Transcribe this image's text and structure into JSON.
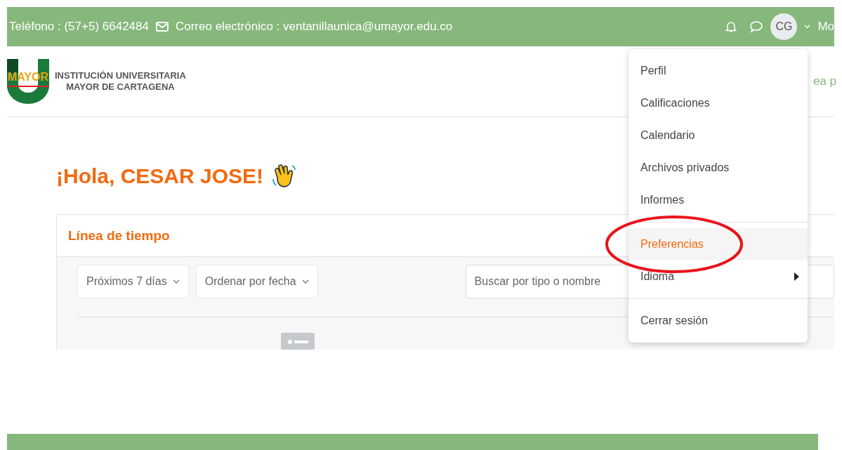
{
  "top_bar": {
    "phone": "Teléfono : (57+5) 6642484",
    "email": "Correo electrónico : ventanillaunica@umayor.edu.co",
    "avatar": "CG",
    "user_menu_partial": "Mo"
  },
  "logo": {
    "mark": "MAYOR",
    "line_1": "INSTITUCIÓN UNIVERSITARIA",
    "line_2": "MAYOR DE CARTAGENA"
  },
  "nav_partial": "ea p",
  "greeting": "¡Hola, CESAR JOSE!",
  "timeline": {
    "title": "Línea de tiempo",
    "filters": [
      {
        "label": "Próximos 7 días"
      },
      {
        "label": "Ordenar por fecha"
      }
    ],
    "search": {
      "placeholder": "Buscar por tipo o nombre"
    }
  },
  "user_menu": {
    "items": [
      {
        "kind": "item",
        "label": "Perfil",
        "selected": false
      },
      {
        "kind": "item",
        "label": "Calificaciones",
        "selected": false
      },
      {
        "kind": "item",
        "label": "Calendario",
        "selected": false
      },
      {
        "kind": "item",
        "label": "Archivos privados",
        "selected": false
      },
      {
        "kind": "item",
        "label": "Informes",
        "selected": false
      },
      {
        "kind": "divider"
      },
      {
        "kind": "item",
        "label": "Preferencias",
        "selected": true
      },
      {
        "kind": "submenu",
        "label": "Idioma",
        "selected": false
      },
      {
        "kind": "divider"
      },
      {
        "kind": "item",
        "label": "Cerrar sesión",
        "selected": false
      }
    ]
  }
}
